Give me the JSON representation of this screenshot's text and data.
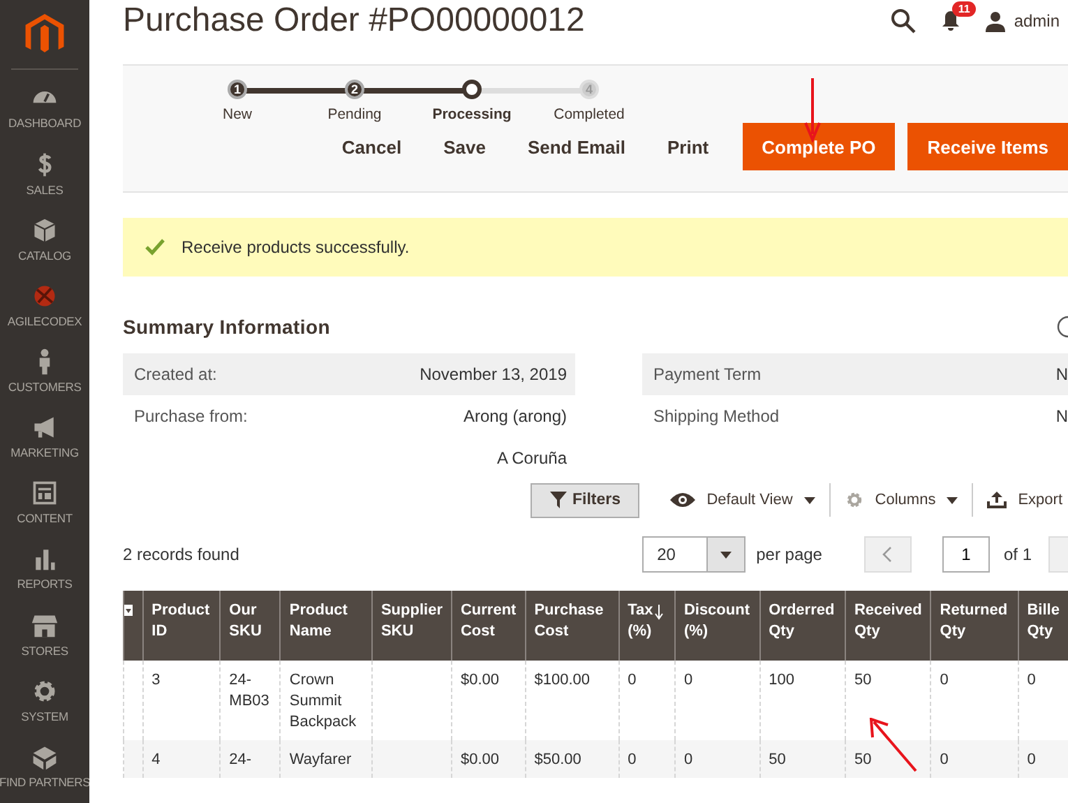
{
  "sidebar": {
    "items": [
      {
        "label": "DASHBOARD",
        "kind": "gauge",
        "selected": false
      },
      {
        "label": "SALES",
        "kind": "dollar",
        "selected": false
      },
      {
        "label": "CATALOG",
        "kind": "box",
        "selected": false
      },
      {
        "label": "AGILECODEX",
        "kind": "brand",
        "selected": false
      },
      {
        "label": "CUSTOMERS",
        "kind": "person",
        "selected": false
      },
      {
        "label": "MARKETING",
        "kind": "megaphone",
        "selected": false
      },
      {
        "label": "CONTENT",
        "kind": "layout",
        "selected": false
      },
      {
        "label": "REPORTS",
        "kind": "bars",
        "selected": false
      },
      {
        "label": "STORES",
        "kind": "store",
        "selected": false
      },
      {
        "label": "SYSTEM",
        "kind": "gear",
        "selected": false
      },
      {
        "label": "FIND PARTNERS",
        "kind": "blocks",
        "selected": false
      }
    ]
  },
  "header": {
    "title": "Purchase Order #PO00000012",
    "notifications": "11",
    "user": "admin"
  },
  "steps": [
    {
      "number": "1",
      "label": "New",
      "completed": true,
      "selected": false
    },
    {
      "number": "2",
      "label": "Pending",
      "completed": true,
      "selected": false
    },
    {
      "label": "Processing",
      "completed": false,
      "selected": true
    },
    {
      "number": "4",
      "label": "Completed",
      "completed": false,
      "selected": false
    }
  ],
  "actions": [
    {
      "label": "Cancel",
      "kind": "link"
    },
    {
      "label": "Save",
      "kind": "link"
    },
    {
      "label": "Send Email",
      "kind": "link"
    },
    {
      "label": "Print",
      "kind": "link"
    },
    {
      "label": "Complete PO",
      "kind": "primary"
    },
    {
      "label": "Receive Items",
      "kind": "primary"
    }
  ],
  "message": {
    "text": "Receive products successfully."
  },
  "summary": {
    "title": "Summary Information",
    "left": [
      {
        "label": "Created at:",
        "value": "November 13, 2019"
      },
      {
        "label": "Purchase from:",
        "value": "Arong (arong)"
      },
      {
        "value": "A Coruña"
      }
    ],
    "right": [
      {
        "label": "Payment Term",
        "value": "N"
      },
      {
        "label": "Shipping Method",
        "value": "N"
      }
    ]
  },
  "grid_toolbar": {
    "filters": "Filters",
    "view": "Default View",
    "columns": "Columns",
    "export": "Export"
  },
  "pager": {
    "records": "2 records found",
    "page_size": "20",
    "per_page": "per page",
    "page": "1",
    "of": "of 1"
  },
  "table": {
    "columns": [
      {
        "label": "Product ID",
        "sorted": false
      },
      {
        "label": "Our SKU",
        "sorted": false
      },
      {
        "label": "Product Name",
        "sorted": false
      },
      {
        "label": "Supplier SKU",
        "sorted": false
      },
      {
        "label": "Current Cost",
        "sorted": false
      },
      {
        "label": "Purchase Cost",
        "sorted": false
      },
      {
        "label": "Tax (%)",
        "sorted": true
      },
      {
        "label": "Discount (%)",
        "sorted": false
      },
      {
        "label": "Orderred Qty",
        "sorted": false
      },
      {
        "label": "Received Qty",
        "sorted": false
      },
      {
        "label": "Returned Qty",
        "sorted": false
      },
      {
        "label": "Bille Qty",
        "sorted": false
      }
    ],
    "rows": [
      [
        "3",
        "24-MB03",
        "Crown Summit Backpack",
        "",
        "$0.00",
        "$100.00",
        "0",
        "0",
        "100",
        "50",
        "0",
        "0"
      ],
      [
        "4",
        "24-",
        "Wayfarer",
        "",
        "$0.00",
        "$50.00",
        "0",
        "0",
        "50",
        "50",
        "0",
        "0"
      ]
    ]
  }
}
